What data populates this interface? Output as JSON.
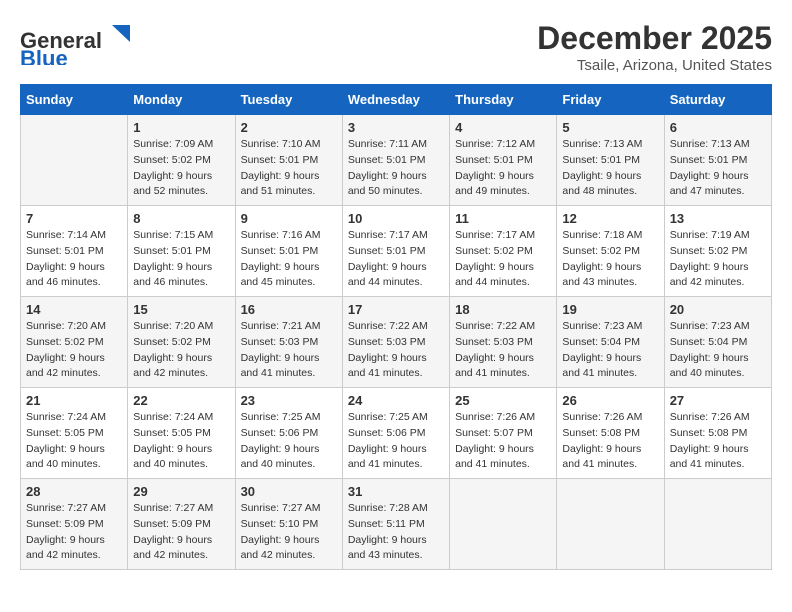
{
  "header": {
    "logo_line1": "General",
    "logo_line2": "Blue",
    "month": "December 2025",
    "location": "Tsaile, Arizona, United States"
  },
  "weekdays": [
    "Sunday",
    "Monday",
    "Tuesday",
    "Wednesday",
    "Thursday",
    "Friday",
    "Saturday"
  ],
  "weeks": [
    [
      {
        "day": "",
        "info": ""
      },
      {
        "day": "1",
        "info": "Sunrise: 7:09 AM\nSunset: 5:02 PM\nDaylight: 9 hours\nand 52 minutes."
      },
      {
        "day": "2",
        "info": "Sunrise: 7:10 AM\nSunset: 5:01 PM\nDaylight: 9 hours\nand 51 minutes."
      },
      {
        "day": "3",
        "info": "Sunrise: 7:11 AM\nSunset: 5:01 PM\nDaylight: 9 hours\nand 50 minutes."
      },
      {
        "day": "4",
        "info": "Sunrise: 7:12 AM\nSunset: 5:01 PM\nDaylight: 9 hours\nand 49 minutes."
      },
      {
        "day": "5",
        "info": "Sunrise: 7:13 AM\nSunset: 5:01 PM\nDaylight: 9 hours\nand 48 minutes."
      },
      {
        "day": "6",
        "info": "Sunrise: 7:13 AM\nSunset: 5:01 PM\nDaylight: 9 hours\nand 47 minutes."
      }
    ],
    [
      {
        "day": "7",
        "info": "Sunrise: 7:14 AM\nSunset: 5:01 PM\nDaylight: 9 hours\nand 46 minutes."
      },
      {
        "day": "8",
        "info": "Sunrise: 7:15 AM\nSunset: 5:01 PM\nDaylight: 9 hours\nand 46 minutes."
      },
      {
        "day": "9",
        "info": "Sunrise: 7:16 AM\nSunset: 5:01 PM\nDaylight: 9 hours\nand 45 minutes."
      },
      {
        "day": "10",
        "info": "Sunrise: 7:17 AM\nSunset: 5:01 PM\nDaylight: 9 hours\nand 44 minutes."
      },
      {
        "day": "11",
        "info": "Sunrise: 7:17 AM\nSunset: 5:02 PM\nDaylight: 9 hours\nand 44 minutes."
      },
      {
        "day": "12",
        "info": "Sunrise: 7:18 AM\nSunset: 5:02 PM\nDaylight: 9 hours\nand 43 minutes."
      },
      {
        "day": "13",
        "info": "Sunrise: 7:19 AM\nSunset: 5:02 PM\nDaylight: 9 hours\nand 42 minutes."
      }
    ],
    [
      {
        "day": "14",
        "info": "Sunrise: 7:20 AM\nSunset: 5:02 PM\nDaylight: 9 hours\nand 42 minutes."
      },
      {
        "day": "15",
        "info": "Sunrise: 7:20 AM\nSunset: 5:02 PM\nDaylight: 9 hours\nand 42 minutes."
      },
      {
        "day": "16",
        "info": "Sunrise: 7:21 AM\nSunset: 5:03 PM\nDaylight: 9 hours\nand 41 minutes."
      },
      {
        "day": "17",
        "info": "Sunrise: 7:22 AM\nSunset: 5:03 PM\nDaylight: 9 hours\nand 41 minutes."
      },
      {
        "day": "18",
        "info": "Sunrise: 7:22 AM\nSunset: 5:03 PM\nDaylight: 9 hours\nand 41 minutes."
      },
      {
        "day": "19",
        "info": "Sunrise: 7:23 AM\nSunset: 5:04 PM\nDaylight: 9 hours\nand 41 minutes."
      },
      {
        "day": "20",
        "info": "Sunrise: 7:23 AM\nSunset: 5:04 PM\nDaylight: 9 hours\nand 40 minutes."
      }
    ],
    [
      {
        "day": "21",
        "info": "Sunrise: 7:24 AM\nSunset: 5:05 PM\nDaylight: 9 hours\nand 40 minutes."
      },
      {
        "day": "22",
        "info": "Sunrise: 7:24 AM\nSunset: 5:05 PM\nDaylight: 9 hours\nand 40 minutes."
      },
      {
        "day": "23",
        "info": "Sunrise: 7:25 AM\nSunset: 5:06 PM\nDaylight: 9 hours\nand 40 minutes."
      },
      {
        "day": "24",
        "info": "Sunrise: 7:25 AM\nSunset: 5:06 PM\nDaylight: 9 hours\nand 41 minutes."
      },
      {
        "day": "25",
        "info": "Sunrise: 7:26 AM\nSunset: 5:07 PM\nDaylight: 9 hours\nand 41 minutes."
      },
      {
        "day": "26",
        "info": "Sunrise: 7:26 AM\nSunset: 5:08 PM\nDaylight: 9 hours\nand 41 minutes."
      },
      {
        "day": "27",
        "info": "Sunrise: 7:26 AM\nSunset: 5:08 PM\nDaylight: 9 hours\nand 41 minutes."
      }
    ],
    [
      {
        "day": "28",
        "info": "Sunrise: 7:27 AM\nSunset: 5:09 PM\nDaylight: 9 hours\nand 42 minutes."
      },
      {
        "day": "29",
        "info": "Sunrise: 7:27 AM\nSunset: 5:09 PM\nDaylight: 9 hours\nand 42 minutes."
      },
      {
        "day": "30",
        "info": "Sunrise: 7:27 AM\nSunset: 5:10 PM\nDaylight: 9 hours\nand 42 minutes."
      },
      {
        "day": "31",
        "info": "Sunrise: 7:28 AM\nSunset: 5:11 PM\nDaylight: 9 hours\nand 43 minutes."
      },
      {
        "day": "",
        "info": ""
      },
      {
        "day": "",
        "info": ""
      },
      {
        "day": "",
        "info": ""
      }
    ]
  ]
}
